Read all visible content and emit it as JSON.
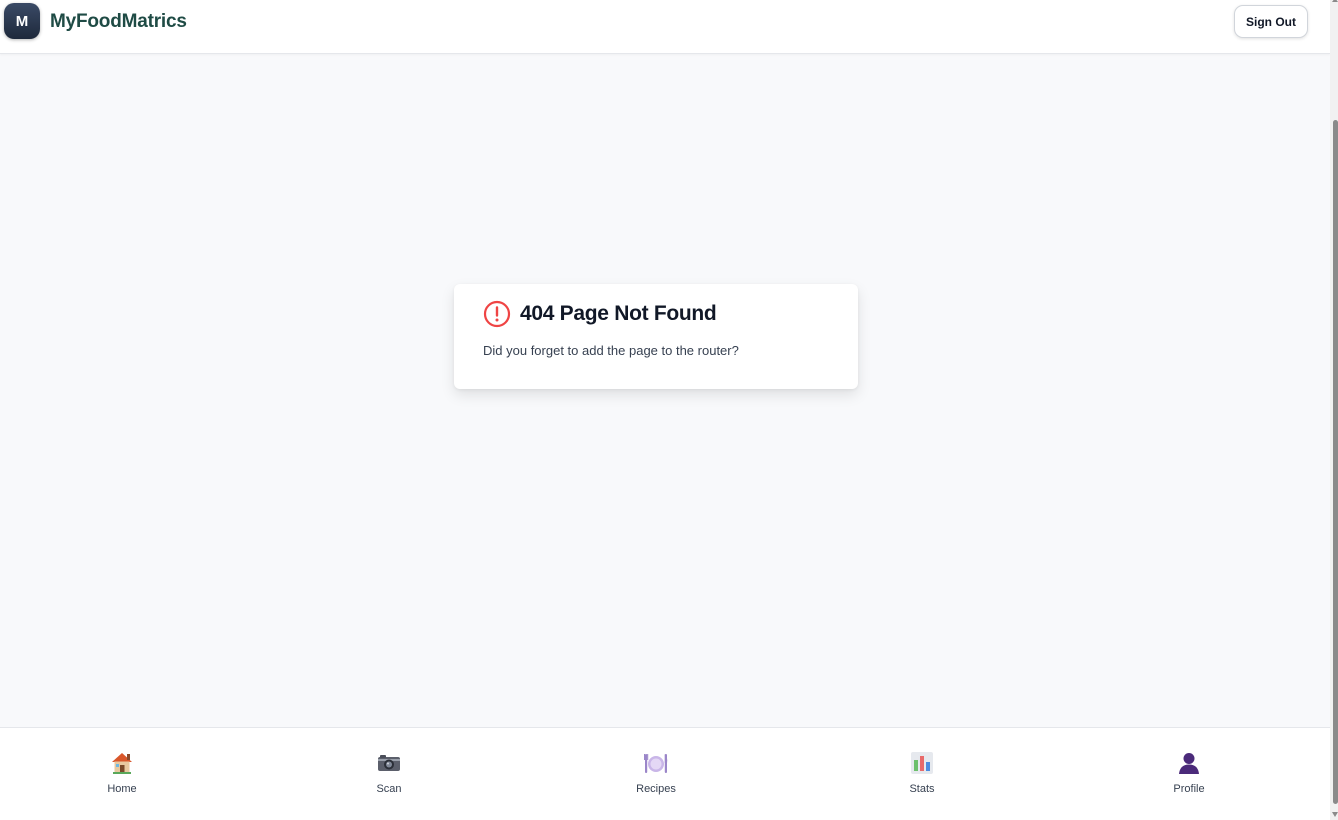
{
  "header": {
    "logo_letter": "M",
    "brand": "MyFoodMatrics",
    "sign_out_label": "Sign Out"
  },
  "error": {
    "title": "404 Page Not Found",
    "message": "Did you forget to add the page to the router?",
    "accent_color": "#ef4444"
  },
  "bottom_nav": {
    "items": [
      {
        "label": "Home",
        "icon": "house-icon"
      },
      {
        "label": "Scan",
        "icon": "camera-icon"
      },
      {
        "label": "Recipes",
        "icon": "plate-icon"
      },
      {
        "label": "Stats",
        "icon": "bar-chart-icon"
      },
      {
        "label": "Profile",
        "icon": "user-silhouette-icon"
      }
    ]
  },
  "colors": {
    "brand_text": "#1f4b45",
    "logo_bg": "#1e293b",
    "page_bg": "#f8f9fb"
  }
}
